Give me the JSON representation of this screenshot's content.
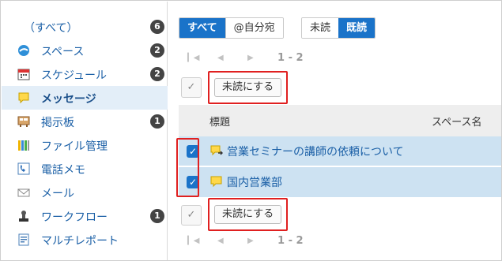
{
  "sidebar": {
    "items": [
      {
        "label": "（すべて）",
        "badge": "6",
        "icon": "all"
      },
      {
        "label": "スペース",
        "badge": "2",
        "icon": "space-icon"
      },
      {
        "label": "スケジュール",
        "badge": "2",
        "icon": "calendar-icon"
      },
      {
        "label": "メッセージ",
        "badge": "",
        "icon": "message-icon",
        "active": true
      },
      {
        "label": "掲示板",
        "badge": "1",
        "icon": "bulletin-board-icon"
      },
      {
        "label": "ファイル管理",
        "badge": "",
        "icon": "file-cabinet-icon"
      },
      {
        "label": "電話メモ",
        "badge": "",
        "icon": "phone-memo-icon"
      },
      {
        "label": "メール",
        "badge": "",
        "icon": "mail-icon"
      },
      {
        "label": "ワークフロー",
        "badge": "1",
        "icon": "workflow-stamp-icon"
      },
      {
        "label": "マルチレポート",
        "badge": "",
        "icon": "multi-report-icon"
      }
    ]
  },
  "filters": {
    "all_label": "すべて",
    "mention_label": "@自分宛",
    "unread_label": "未読",
    "read_label": "既読"
  },
  "pager": {
    "range": "1 - 2"
  },
  "actions": {
    "mark_unread_label": "未読にする"
  },
  "table": {
    "columns": [
      "標題",
      "スペース名"
    ],
    "rows": [
      {
        "subject": "営業セミナーの講師の依頼について",
        "space": "",
        "checked": true,
        "icon": "message-forward-icon"
      },
      {
        "subject": "国内営業部",
        "space": "",
        "checked": true,
        "icon": "message-icon"
      }
    ]
  },
  "colors": {
    "accent": "#1a73c9",
    "highlight": "#e02020",
    "row_selected": "#cde2f2"
  }
}
